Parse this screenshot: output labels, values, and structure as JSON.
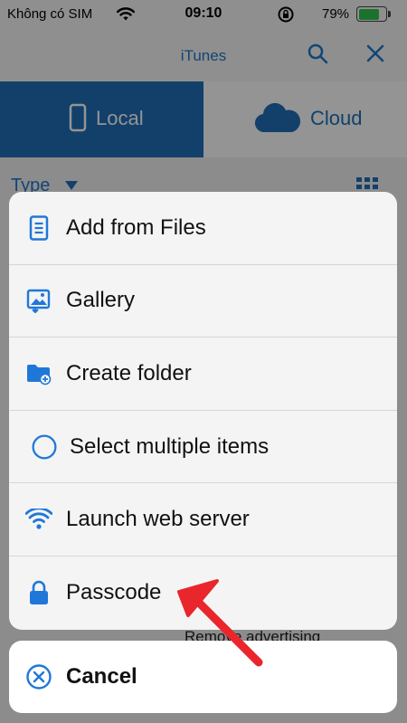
{
  "status_bar": {
    "carrier": "Không có SIM",
    "time": "09:10",
    "battery_percent": "79%",
    "battery_level": 0.79,
    "battery_color": "#2fc552"
  },
  "nav": {
    "title": "iTunes"
  },
  "segment": {
    "local_label": "Local",
    "cloud_label": "Cloud",
    "selected": "Local",
    "accent_color": "#1f6eb8"
  },
  "type_filter": {
    "label": "Type"
  },
  "background_item": {
    "label": "Remove advertising"
  },
  "action_sheet": {
    "items": [
      {
        "label": "Add from Files",
        "icon": "document-icon"
      },
      {
        "label": "Gallery",
        "icon": "gallery-icon"
      },
      {
        "label": "Create folder",
        "icon": "folder-add-icon"
      },
      {
        "label": "Select multiple items",
        "icon": "circle-icon"
      },
      {
        "label": "Launch web server",
        "icon": "wifi-icon"
      },
      {
        "label": "Passcode",
        "icon": "lock-icon"
      }
    ],
    "cancel_label": "Cancel",
    "icon_color": "#1f78d8",
    "highlight_arrow_color": "#e8262b"
  }
}
